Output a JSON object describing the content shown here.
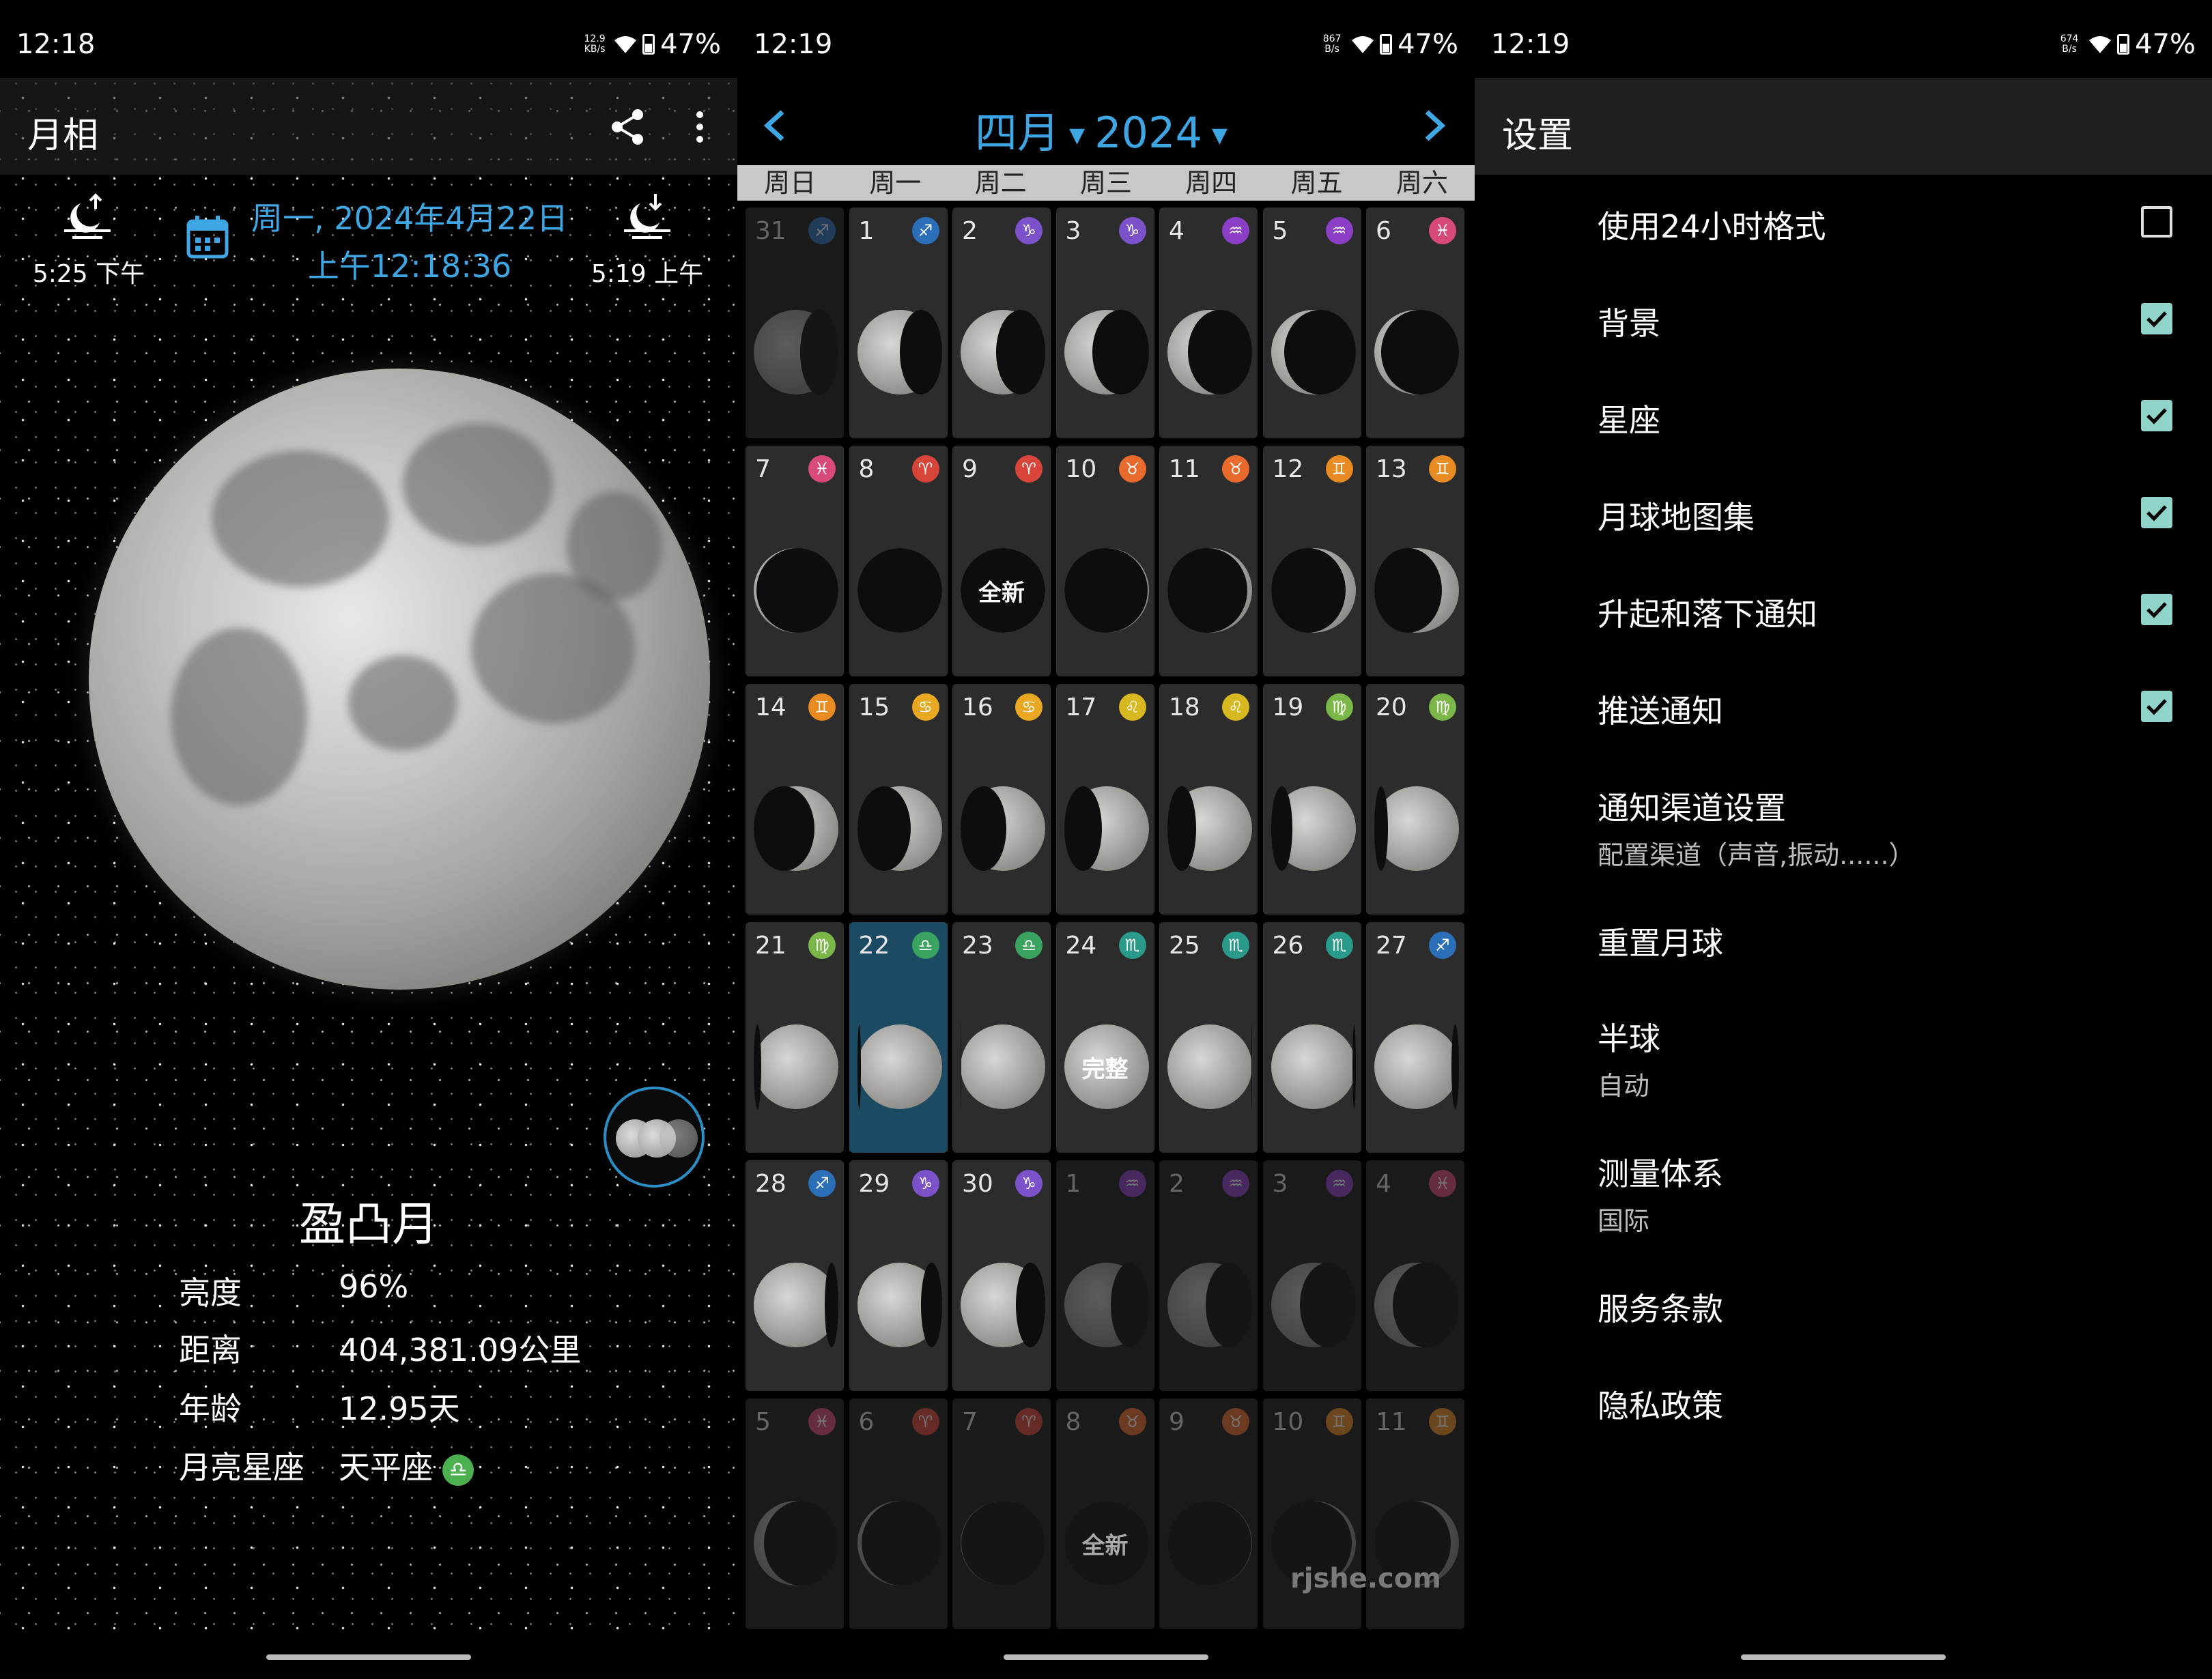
{
  "status": [
    {
      "time": "12:18",
      "speed_top": "12.9",
      "speed_bottom": "KB/s",
      "battery": "47%"
    },
    {
      "time": "12:19",
      "speed_top": "867",
      "speed_bottom": "B/s",
      "battery": "47%"
    },
    {
      "time": "12:19",
      "speed_top": "674",
      "speed_bottom": "B/s",
      "battery": "47%"
    }
  ],
  "moon_screen": {
    "title": "月相",
    "share_icon": "share-icon",
    "more_icon": "more-vert-icon",
    "moonrise": {
      "icon": "moonrise-icon",
      "time": "5:25 下午"
    },
    "moonset": {
      "icon": "moonset-icon",
      "time": "5:19 上午"
    },
    "calendar_icon": "calendar-icon",
    "date": "周一, 2024年4月22日",
    "clock": "上午12:18:36",
    "phase": "盈凸月",
    "details": [
      {
        "label": "亮度",
        "value": "96%"
      },
      {
        "label": "距离",
        "value": "404,381.09公里"
      },
      {
        "label": "年龄",
        "value": "12.95天"
      },
      {
        "label": "月亮星座",
        "value": "天平座",
        "sign": "♎"
      }
    ],
    "accent": "#3fa6e4"
  },
  "calendar": {
    "month": "四月",
    "year": "2024",
    "weekdays": [
      "周日",
      "周一",
      "周二",
      "周三",
      "周四",
      "周五",
      "周六"
    ],
    "days": [
      {
        "n": "31",
        "z": "♐",
        "c": "#2a6fb8",
        "dim": true,
        "lit": 0.55,
        "side": "l"
      },
      {
        "n": "1",
        "z": "♐",
        "c": "#2a6fb8",
        "lit": 0.5,
        "side": "l"
      },
      {
        "n": "2",
        "z": "♑",
        "c": "#7b52c9",
        "lit": 0.42,
        "side": "l"
      },
      {
        "n": "3",
        "z": "♑",
        "c": "#7b52c9",
        "lit": 0.33,
        "side": "l"
      },
      {
        "n": "4",
        "z": "♒",
        "c": "#8b3fc7",
        "lit": 0.24,
        "side": "l"
      },
      {
        "n": "5",
        "z": "♒",
        "c": "#8b3fc7",
        "lit": 0.15,
        "side": "l"
      },
      {
        "n": "6",
        "z": "♓",
        "c": "#d84a7a",
        "lit": 0.08,
        "side": "l"
      },
      {
        "n": "7",
        "z": "♓",
        "c": "#d84a7a",
        "lit": 0.03,
        "side": "l"
      },
      {
        "n": "8",
        "z": "♈",
        "c": "#d8453a",
        "lit": 0.0,
        "side": "l"
      },
      {
        "n": "9",
        "z": "♈",
        "c": "#d8453a",
        "lit": 0.0,
        "side": "l",
        "label": "全新"
      },
      {
        "n": "10",
        "z": "♉",
        "c": "#e86b2d",
        "lit": 0.02,
        "side": "r"
      },
      {
        "n": "11",
        "z": "♉",
        "c": "#e86b2d",
        "lit": 0.06,
        "side": "r"
      },
      {
        "n": "12",
        "z": "♊",
        "c": "#e88b22",
        "lit": 0.12,
        "side": "r"
      },
      {
        "n": "13",
        "z": "♊",
        "c": "#e88b22",
        "lit": 0.2,
        "side": "r"
      },
      {
        "n": "14",
        "z": "♊",
        "c": "#e88b22",
        "lit": 0.28,
        "side": "r"
      },
      {
        "n": "15",
        "z": "♋",
        "c": "#e8a822",
        "lit": 0.37,
        "side": "r"
      },
      {
        "n": "16",
        "z": "♋",
        "c": "#e8a822",
        "lit": 0.46,
        "side": "r"
      },
      {
        "n": "17",
        "z": "♌",
        "c": "#d8b820",
        "lit": 0.56,
        "side": "r"
      },
      {
        "n": "18",
        "z": "♌",
        "c": "#d8b820",
        "lit": 0.66,
        "side": "r"
      },
      {
        "n": "19",
        "z": "♍",
        "c": "#7ab648",
        "lit": 0.75,
        "side": "r"
      },
      {
        "n": "20",
        "z": "♍",
        "c": "#7ab648",
        "lit": 0.84,
        "side": "r"
      },
      {
        "n": "21",
        "z": "♍",
        "c": "#7ab648",
        "lit": 0.91,
        "side": "r"
      },
      {
        "n": "22",
        "z": "♎",
        "c": "#3aa360",
        "lit": 0.96,
        "side": "r",
        "selected": true
      },
      {
        "n": "23",
        "z": "♎",
        "c": "#3aa360",
        "lit": 0.99,
        "side": "r"
      },
      {
        "n": "24",
        "z": "♏",
        "c": "#2a9a8a",
        "lit": 1.0,
        "side": "r",
        "label": "完整"
      },
      {
        "n": "25",
        "z": "♏",
        "c": "#2a9a8a",
        "lit": 0.99,
        "side": "l"
      },
      {
        "n": "26",
        "z": "♏",
        "c": "#2a9a8a",
        "lit": 0.96,
        "side": "l"
      },
      {
        "n": "27",
        "z": "♐",
        "c": "#2a6fb8",
        "lit": 0.91,
        "side": "l"
      },
      {
        "n": "28",
        "z": "♐",
        "c": "#2a6fb8",
        "lit": 0.84,
        "side": "l"
      },
      {
        "n": "29",
        "z": "♑",
        "c": "#7b52c9",
        "lit": 0.75,
        "side": "l"
      },
      {
        "n": "30",
        "z": "♑",
        "c": "#7b52c9",
        "lit": 0.65,
        "side": "l"
      },
      {
        "n": "1",
        "z": "♒",
        "c": "#8b3fc7",
        "dim": true,
        "lit": 0.55,
        "side": "l"
      },
      {
        "n": "2",
        "z": "♒",
        "c": "#8b3fc7",
        "dim": true,
        "lit": 0.45,
        "side": "l"
      },
      {
        "n": "3",
        "z": "♒",
        "c": "#8b3fc7",
        "dim": true,
        "lit": 0.34,
        "side": "l"
      },
      {
        "n": "4",
        "z": "♓",
        "c": "#d84a7a",
        "dim": true,
        "lit": 0.22,
        "side": "l"
      },
      {
        "n": "5",
        "z": "♓",
        "c": "#d84a7a",
        "dim": true,
        "lit": 0.12,
        "side": "l"
      },
      {
        "n": "6",
        "z": "♈",
        "c": "#d8453a",
        "dim": true,
        "lit": 0.05,
        "side": "l"
      },
      {
        "n": "7",
        "z": "♈",
        "c": "#d8453a",
        "dim": true,
        "lit": 0.01,
        "side": "l"
      },
      {
        "n": "8",
        "z": "♉",
        "c": "#e86b2d",
        "dim": true,
        "lit": 0.0,
        "side": "l",
        "label": "全新"
      },
      {
        "n": "9",
        "z": "♉",
        "c": "#e86b2d",
        "dim": true,
        "lit": 0.01,
        "side": "r"
      },
      {
        "n": "10",
        "z": "♊",
        "c": "#e88b22",
        "dim": true,
        "lit": 0.05,
        "side": "r"
      },
      {
        "n": "11",
        "z": "♊",
        "c": "#e88b22",
        "dim": true,
        "lit": 0.1,
        "side": "r"
      }
    ],
    "watermark": "rjshe.com"
  },
  "settings": {
    "title": "设置",
    "items": [
      {
        "title": "使用24小时格式",
        "checkbox": false
      },
      {
        "title": "背景",
        "checkbox": true
      },
      {
        "title": "星座",
        "checkbox": true
      },
      {
        "title": "月球地图集",
        "checkbox": true
      },
      {
        "title": "升起和落下通知",
        "checkbox": true
      },
      {
        "title": "推送通知",
        "checkbox": true
      },
      {
        "title": "通知渠道设置",
        "sub": "配置渠道（声音,振动......）"
      },
      {
        "title": "重置月球"
      },
      {
        "title": "半球",
        "sub": "自动"
      },
      {
        "title": "测量体系",
        "sub": "国际"
      },
      {
        "title": "服务条款"
      },
      {
        "title": "隐私政策"
      }
    ],
    "check_color": "#8fd3c9"
  }
}
